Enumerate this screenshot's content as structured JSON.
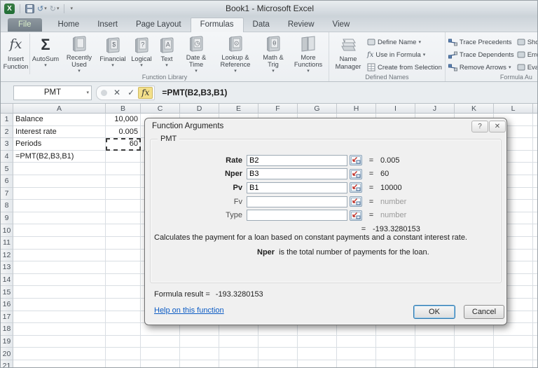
{
  "window": {
    "title": "Book1 - Microsoft Excel"
  },
  "icons": {
    "excel_logo": "X",
    "undo": "↺",
    "redo": "↻",
    "dropdown": "▾",
    "name_box_caret": "▾",
    "formula_cancel": "✕",
    "formula_enter": "✓",
    "formula_fx": "fx",
    "insert_function_glyph": "fx",
    "autosum_glyph": "Σ",
    "dialog_help": "?",
    "dialog_close": "✕"
  },
  "tabs": {
    "file": "File",
    "items": [
      "Home",
      "Insert",
      "Page Layout",
      "Formulas",
      "Data",
      "Review",
      "View"
    ],
    "active_index": 3
  },
  "ribbon": {
    "function_library": {
      "label": "Function Library",
      "buttons": [
        {
          "id": "insert-function",
          "label": "Insert Function",
          "icon": "fx-large",
          "arrow": false
        },
        {
          "id": "autosum",
          "label": "AutoSum",
          "icon": "sigma",
          "arrow": true
        },
        {
          "id": "recently-used",
          "label": "Recently Used",
          "icon": "book",
          "glyph": "",
          "arrow": true
        },
        {
          "id": "financial",
          "label": "Financial",
          "icon": "book",
          "glyph": "$",
          "arrow": true
        },
        {
          "id": "logical",
          "label": "Logical",
          "icon": "book",
          "glyph": "?",
          "arrow": true
        },
        {
          "id": "text",
          "label": "Text",
          "icon": "book",
          "glyph": "A",
          "arrow": true
        },
        {
          "id": "date-time",
          "label": "Date & Time",
          "icon": "book",
          "glyph": "◷",
          "arrow": true
        },
        {
          "id": "lookup-reference",
          "label": "Lookup & Reference",
          "icon": "book",
          "glyph": "⊙",
          "arrow": true
        },
        {
          "id": "math-trig",
          "label": "Math & Trig",
          "icon": "book",
          "glyph": "θ",
          "arrow": true
        },
        {
          "id": "more-functions",
          "label": "More Functions",
          "icon": "books",
          "glyph": "",
          "arrow": true
        }
      ]
    },
    "defined_names": {
      "label": "Defined Names",
      "name_manager": {
        "label": "Name Manager"
      },
      "items": [
        {
          "id": "define-name",
          "label": "Define Name",
          "arrow": true
        },
        {
          "id": "use-in-formula",
          "label": "Use in Formula",
          "arrow": true
        },
        {
          "id": "create-from-selection",
          "label": "Create from Selection",
          "arrow": false
        }
      ]
    },
    "formula_auditing": {
      "label": "Formula Au",
      "col1": [
        {
          "id": "trace-precedents",
          "label": "Trace Precedents",
          "arrow": false
        },
        {
          "id": "trace-dependents",
          "label": "Trace Dependents",
          "arrow": false
        },
        {
          "id": "remove-arrows",
          "label": "Remove Arrows",
          "arrow": true
        }
      ],
      "col2": [
        {
          "id": "show-formulas",
          "label": "Sho"
        },
        {
          "id": "error-checking",
          "label": "Erro"
        },
        {
          "id": "evaluate-formula",
          "label": "Eval"
        }
      ]
    }
  },
  "formula_bar": {
    "name_box": "PMT",
    "formula": "=PMT(B2,B3,B1)"
  },
  "grid": {
    "columns": [
      "A",
      "B",
      "C",
      "D",
      "E",
      "F",
      "G",
      "H",
      "I",
      "J",
      "K",
      "L"
    ],
    "row_count": 21,
    "cells": {
      "A1": "Balance",
      "B1": "10,000",
      "A2": "Interest rate",
      "B2": "0.005",
      "A3": "Periods",
      "B3": "60",
      "A4": "=PMT(B2,B3,B1)"
    },
    "selected_cell": "B3"
  },
  "dialog": {
    "title": "Function Arguments",
    "group_label": "PMT",
    "equals_sign": "=",
    "fields": [
      {
        "name": "Rate",
        "value": "B2",
        "result": "0.005",
        "filled": true
      },
      {
        "name": "Nper",
        "value": "B3",
        "result": "60",
        "filled": true
      },
      {
        "name": "Pv",
        "value": "B1",
        "result": "10000",
        "filled": true
      },
      {
        "name": "Fv",
        "value": "",
        "result": "number",
        "filled": false
      },
      {
        "name": "Type",
        "value": "",
        "result": "number",
        "filled": false
      }
    ],
    "overall_result": "-193.3280153",
    "description": "Calculates the payment for a loan based on constant payments and a constant interest rate.",
    "arg_help": {
      "term": "Nper",
      "text": "is the total number of payments for the loan."
    },
    "formula_result_label": "Formula result =",
    "formula_result_value": "-193.3280153",
    "help_link": "Help on this function",
    "ok_label": "OK",
    "cancel_label": "Cancel"
  },
  "colors": {
    "fx_highlight": "#f3e08a",
    "link": "#0b5bc4",
    "file_tab_text": "#d9eec9",
    "ok_focus_border": "#3079ad",
    "marching_ants": "#3c3c3c"
  }
}
